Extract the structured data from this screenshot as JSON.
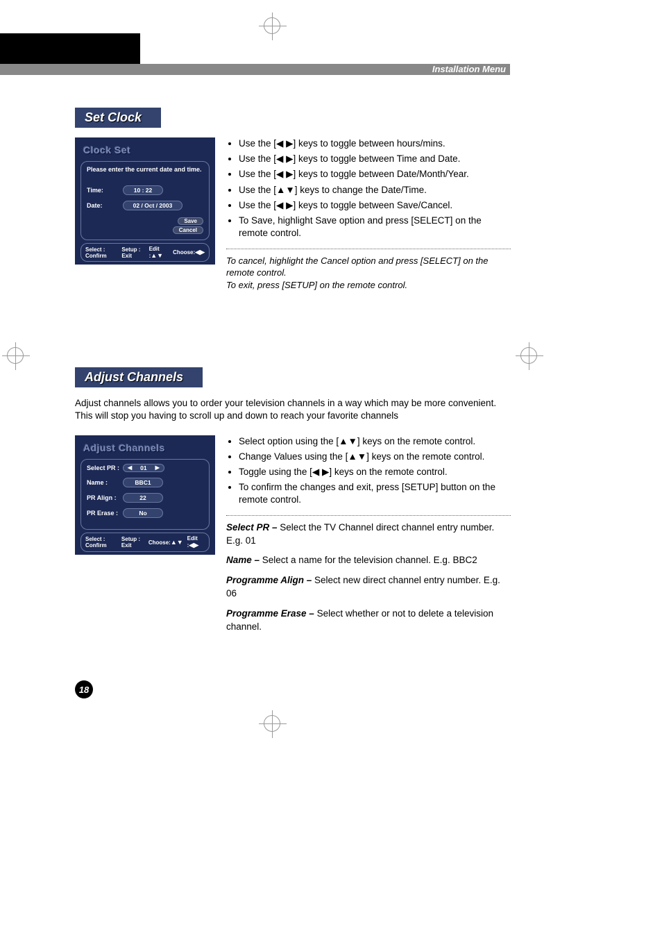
{
  "header": {
    "title": "Installation Menu"
  },
  "page_number": "18",
  "set_clock": {
    "tab": "Set Clock",
    "osd": {
      "title": "Clock Set",
      "msg": "Please enter the current date and time.",
      "time_label": "Time:",
      "time_value": "10 : 22",
      "date_label": "Date:",
      "date_value": "02 / Oct / 2003",
      "save": "Save",
      "cancel": "Cancel",
      "footer": {
        "f1": "Select : Confirm",
        "f2": "Setup : Exit",
        "f3": "Edit :",
        "f4": "Choose:"
      }
    },
    "bullets": [
      "Use the [◀ ▶] keys to toggle between hours/mins.",
      "Use the [◀ ▶] keys to toggle between Time and Date.",
      "Use the [◀ ▶] keys to toggle between Date/Month/Year.",
      "Use the [▲▼] keys to change the Date/Time.",
      "Use the [◀ ▶] keys to toggle between Save/Cancel.",
      "To Save, highlight Save option and press [SELECT] on the remote control."
    ],
    "note1": "To cancel, highlight the Cancel option and press [SELECT] on the remote control.",
    "note2": "To exit, press [SETUP] on the remote control."
  },
  "adjust_channels": {
    "tab": "Adjust Channels",
    "intro": "Adjust channels allows you to order your television channels in a way which may be more convenient. This will stop you having to scroll up and down to reach your favorite channels",
    "osd": {
      "title": "Adjust Channels",
      "rows": {
        "select_pr_label": "Select PR :",
        "select_pr_value": "01",
        "name_label": "Name :",
        "name_value": "BBC1",
        "pr_align_label": "PR Align :",
        "pr_align_value": "22",
        "pr_erase_label": "PR Erase :",
        "pr_erase_value": "No"
      },
      "footer": {
        "f1": "Select : Confirm",
        "f2": "Setup : Exit",
        "f3": "Choose:",
        "f4": "Edit :"
      }
    },
    "bullets": [
      "Select option using the  [▲▼] keys on the remote control.",
      "Change Values using the  [▲▼] keys on the remote control.",
      "Toggle using the [◀ ▶] keys on the remote control.",
      "To confirm the changes and exit, press [SETUP] button on the remote control."
    ],
    "defs": {
      "select_pr_term": "Select PR –",
      "select_pr_body": "  Select the TV Channel direct channel entry number. E.g. 01",
      "name_term": "Name –",
      "name_body": " Select a name for the television channel. E.g. BBC2",
      "align_term": "Programme Align –",
      "align_body": " Select new direct channel entry number. E.g. 06",
      "erase_term": "Programme Erase –",
      "erase_body": " Select whether or not to delete a television channel."
    }
  }
}
